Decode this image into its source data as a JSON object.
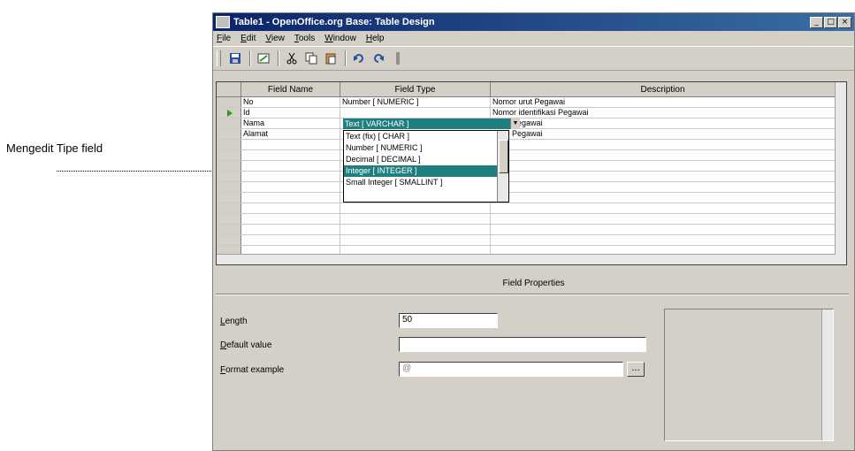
{
  "annotation": {
    "label": "Mengedit Tipe field"
  },
  "window": {
    "title": "Table1 - OpenOffice.org Base: Table Design",
    "buttons": {
      "minimize": "_",
      "maximize": "□",
      "close": "×"
    }
  },
  "menu": [
    "File",
    "Edit",
    "View",
    "Tools",
    "Window",
    "Help"
  ],
  "grid": {
    "headers": [
      "Field Name",
      "Field Type",
      "Description"
    ],
    "rows": [
      {
        "name": "No",
        "type": "Number [ NUMERIC ]",
        "desc": "Nomor urut Pegawai"
      },
      {
        "name": "Id",
        "type": "Text [ VARCHAR ]",
        "desc": "Nomor identifikasi Pegawai"
      },
      {
        "name": "Nama",
        "type": "",
        "desc": "Pegawai"
      },
      {
        "name": "Alamat",
        "type": "",
        "desc": "Pegawai"
      }
    ],
    "dropdown_options": [
      "Text (fix) [ CHAR ]",
      "Number [ NUMERIC ]",
      "Decimal [ DECIMAL ]",
      "Integer [ INTEGER ]",
      "Small Integer [ SMALLINT ]"
    ],
    "dropdown_selected": "Integer [ INTEGER ]"
  },
  "properties": {
    "title": "Field Properties",
    "length_label": "Length",
    "length_value": "50",
    "default_label": "Default value",
    "default_value": "",
    "format_label": "Format example",
    "format_value": "@",
    "format_button": "..."
  },
  "colors": {
    "accent": "#1f7f7f",
    "titlebar": "#0a246a"
  }
}
